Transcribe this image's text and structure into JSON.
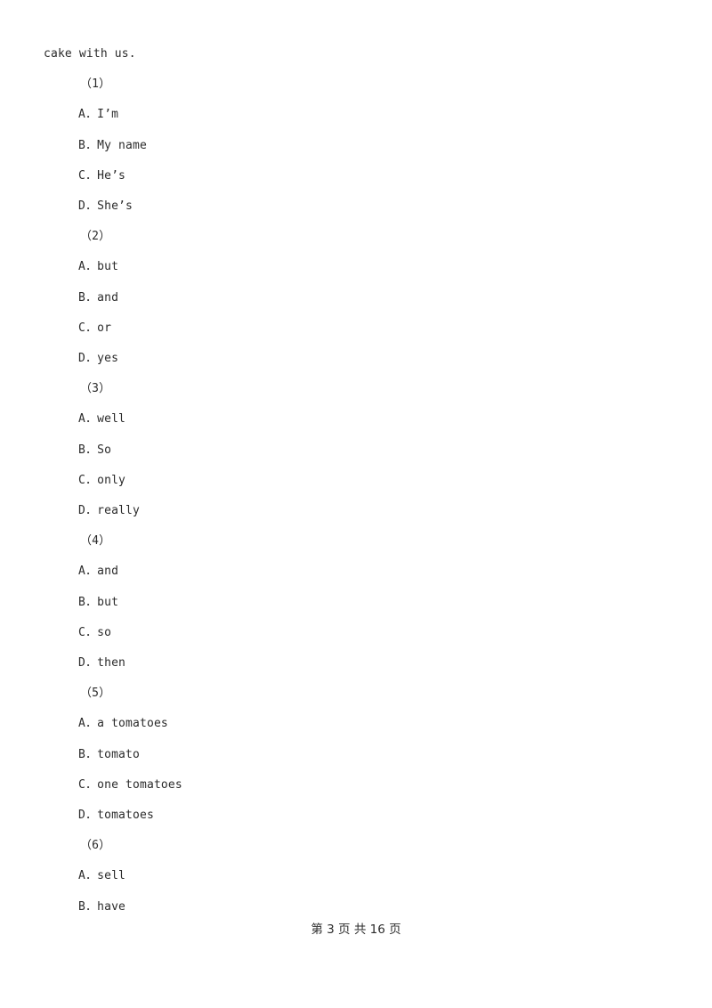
{
  "document": {
    "background_color": "#ffffff",
    "text_color": "#2b2b2b",
    "stem_fragment": "cake with us."
  },
  "questions": [
    {
      "number": "（1）",
      "options": [
        "A．I’m",
        "B．My name",
        "C．He’s",
        "D．She’s"
      ]
    },
    {
      "number": "（2）",
      "options": [
        "A．but",
        "B．and",
        "C．or",
        "D．yes"
      ]
    },
    {
      "number": "（3）",
      "options": [
        "A．well",
        "B．So",
        "C．only",
        "D．really"
      ]
    },
    {
      "number": "（4）",
      "options": [
        "A．and",
        "B．but",
        "C．so",
        "D．then"
      ]
    },
    {
      "number": "（5）",
      "options": [
        "A．a tomatoes",
        "B．tomato",
        "C．one tomatoes",
        "D．tomatoes"
      ]
    },
    {
      "number": "（6）",
      "options": [
        "A．sell",
        "B．have"
      ]
    }
  ],
  "footer": {
    "text": "第 3 页 共 16 页",
    "current_page": "3",
    "total_pages": "16"
  }
}
